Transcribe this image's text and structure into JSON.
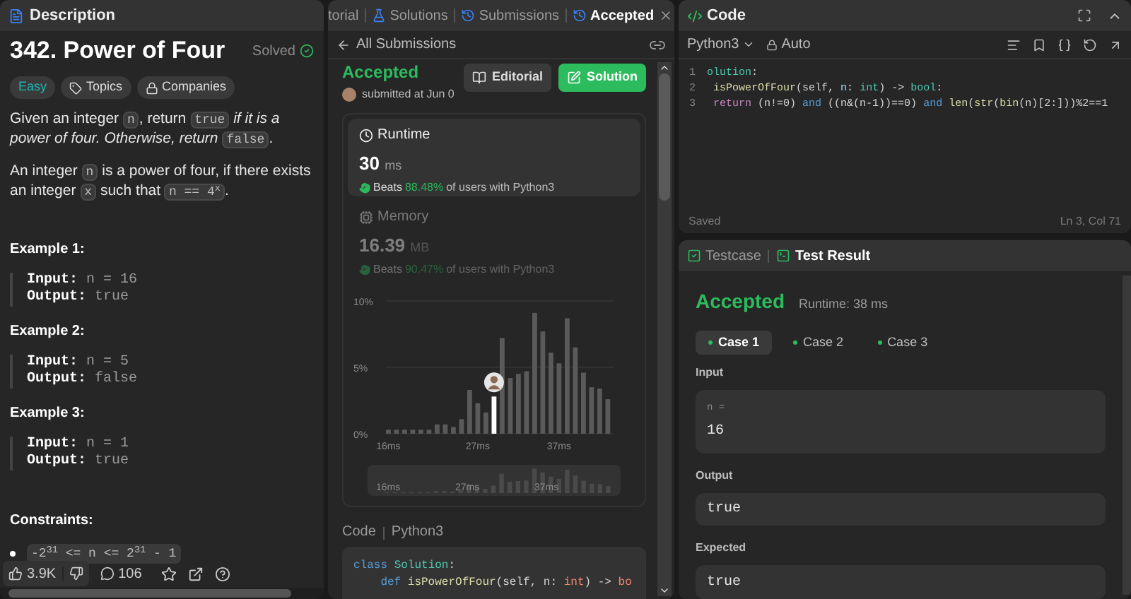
{
  "description_panel": {
    "tab": "Description",
    "title": "342. Power of Four",
    "status": "Solved",
    "tags": [
      {
        "kind": "difficulty",
        "label": "Easy"
      },
      {
        "kind": "topics",
        "label": "Topics"
      },
      {
        "kind": "companies",
        "label": "Companies"
      }
    ],
    "paragraphs": [
      [
        {
          "kind": "text",
          "text": "Given an integer "
        },
        {
          "kind": "code",
          "text": "n"
        },
        {
          "kind": "text",
          "text": ", return "
        },
        {
          "kind": "code",
          "text": "true"
        },
        {
          "kind": "italic",
          "text": " if it is a power of four. Otherwise, return "
        },
        {
          "kind": "code",
          "text": "false"
        },
        {
          "kind": "text",
          "text": "."
        }
      ],
      [
        {
          "kind": "text",
          "text": "An integer "
        },
        {
          "kind": "code",
          "text": "n"
        },
        {
          "kind": "text",
          "text": " is a power of four, if there exists an integer "
        },
        {
          "kind": "code",
          "text": "x"
        },
        {
          "kind": "text",
          "text": " such that "
        },
        {
          "kind": "code",
          "text": "n == 4$^{x}$"
        },
        {
          "kind": "text",
          "text": "."
        }
      ]
    ],
    "examples": [
      {
        "title": "Example 1:",
        "lines": [
          {
            "label": "Input:",
            "value": "n = 16"
          },
          {
            "label": "Output:",
            "value": "true"
          }
        ]
      },
      {
        "title": "Example 2:",
        "lines": [
          {
            "label": "Input:",
            "value": "n = 5"
          },
          {
            "label": "Output:",
            "value": "false"
          }
        ]
      },
      {
        "title": "Example 3:",
        "lines": [
          {
            "label": "Input:",
            "value": "n = 1"
          },
          {
            "label": "Output:",
            "value": "true"
          }
        ]
      }
    ],
    "constraints": {
      "title": "Constraints:",
      "items": [
        "-2$^{31}$ <= n <= 2$^{31}$ - 1"
      ]
    },
    "toolbar": {
      "likes": "3.9K",
      "comments": "106"
    }
  },
  "submission_panel": {
    "tabs": [
      {
        "kind": "editorial",
        "label": "torial",
        "selected": false,
        "closable": false
      },
      {
        "kind": "solutions",
        "label": "Solutions",
        "selected": false,
        "closable": false
      },
      {
        "kind": "submissions",
        "label": "Submissions",
        "selected": false,
        "closable": false
      },
      {
        "kind": "accepted",
        "label": "Accepted",
        "selected": true,
        "closable": true
      }
    ],
    "back_link": "All Submissions",
    "status": "Accepted",
    "submitted": "submitted at Jun 0",
    "buttons": [
      {
        "kind": "secondary",
        "label": "Editorial"
      },
      {
        "kind": "primary",
        "label": "Solution"
      }
    ],
    "stats": [
      {
        "kind": "runtime",
        "label": "Runtime",
        "selected": true,
        "value": "30",
        "unit": "ms",
        "beats": "Beats",
        "percent": "88.48%",
        "suffix": "of users with Python3"
      },
      {
        "kind": "memory",
        "label": "Memory",
        "selected": false,
        "value": "16.39",
        "unit": "MB",
        "beats": "Beats",
        "percent": "90.47%",
        "suffix": "of users with Python3"
      }
    ],
    "chart_data": {
      "type": "bar",
      "x": [
        16,
        17,
        18,
        19,
        20,
        21,
        22,
        23,
        24,
        25,
        26,
        27,
        28,
        29,
        30,
        31,
        32,
        33,
        34,
        35,
        36,
        37,
        38,
        39,
        40,
        41,
        42,
        43
      ],
      "series": [
        {
          "color": "#5a5a5a",
          "values": [
            0.3,
            0.3,
            0.3,
            0.3,
            0.3,
            0.3,
            0.7,
            0.7,
            0.5,
            1.1,
            3.3,
            2.3,
            1.6,
            null,
            7.2,
            4.2,
            4.5,
            4.7,
            9.1,
            7.7,
            6.1,
            5.3,
            8.7,
            6.5,
            4.6,
            3.5,
            3.4,
            2.6
          ]
        },
        {
          "color": "#ffffff",
          "values": [
            null,
            null,
            null,
            null,
            null,
            null,
            null,
            null,
            null,
            null,
            null,
            null,
            null,
            2.8,
            null,
            null,
            null,
            null,
            null,
            null,
            null,
            null,
            null,
            null,
            null,
            null,
            null,
            null
          ]
        }
      ],
      "xlim": [
        15.5,
        43.5
      ],
      "ylim": [
        0,
        10
      ],
      "yticks": [
        {
          "value": 0,
          "label": "0%"
        },
        {
          "value": 5,
          "label": "5%"
        },
        {
          "value": 10,
          "label": "10%"
        }
      ],
      "xticks": [
        {
          "value": 16,
          "label": "16ms"
        },
        {
          "value": 27,
          "label": "27ms"
        },
        {
          "value": 37,
          "label": "37ms"
        }
      ]
    },
    "overview_labels": [
      "16ms",
      "27ms",
      "37ms"
    ],
    "code_header": {
      "label": "Code",
      "language": "Python3"
    },
    "code_lines": [
      [
        {
          "kind": "keyword",
          "text": "class "
        },
        {
          "kind": "class",
          "text": "Solution"
        },
        {
          "kind": "plain",
          "text": ":"
        }
      ],
      [
        {
          "kind": "keyword",
          "text": "    def "
        },
        {
          "kind": "function",
          "text": "isPowerOfFour"
        },
        {
          "kind": "plain",
          "text": "(self, n: "
        },
        {
          "kind": "type",
          "text": "int"
        },
        {
          "kind": "plain",
          "text": ") -> "
        },
        {
          "kind": "type",
          "text": "bo"
        }
      ]
    ]
  },
  "code_editor": {
    "title": "Code",
    "language": "Python3",
    "mode": "Auto",
    "lines": [
      {
        "number": "1",
        "tokens": [
          {
            "kind": "class",
            "text": "olution"
          },
          {
            "kind": "plain",
            "text": ":"
          }
        ]
      },
      {
        "number": "2",
        "tokens": [
          {
            "kind": "function",
            "text": " isPowerOfFour"
          },
          {
            "kind": "plain",
            "text": "(self, "
          },
          {
            "kind": "param",
            "text": "n"
          },
          {
            "kind": "plain",
            "text": ": "
          },
          {
            "kind": "class",
            "text": "int"
          },
          {
            "kind": "plain",
            "text": ") -> "
          },
          {
            "kind": "class",
            "text": "bool"
          },
          {
            "kind": "plain",
            "text": ":"
          }
        ]
      },
      {
        "number": "3",
        "tokens": [
          {
            "kind": "control",
            "text": " return"
          },
          {
            "kind": "plain",
            "text": " (n!=0) "
          },
          {
            "kind": "keyword",
            "text": "and"
          },
          {
            "kind": "plain",
            "text": " ((n&(n-1))==0) "
          },
          {
            "kind": "keyword",
            "text": "and "
          },
          {
            "kind": "function",
            "text": "len"
          },
          {
            "kind": "plain",
            "text": "("
          },
          {
            "kind": "function",
            "text": "str"
          },
          {
            "kind": "plain",
            "text": "("
          },
          {
            "kind": "function",
            "text": "bin"
          },
          {
            "kind": "plain",
            "text": "(n)[2:]))%2==1"
          }
        ]
      }
    ],
    "status": "Saved",
    "cursor": "Ln 3, Col 71"
  },
  "test_result": {
    "tabs": [
      {
        "kind": "testcase",
        "label": "Testcase",
        "selected": false
      },
      {
        "kind": "result",
        "label": "Test Result",
        "selected": true
      }
    ],
    "verdict": "Accepted",
    "runtime": "Runtime: 38 ms",
    "cases": [
      {
        "label": "Case 1",
        "selected": true,
        "passed": true
      },
      {
        "label": "Case 2",
        "selected": false,
        "passed": true
      },
      {
        "label": "Case 3",
        "selected": false,
        "passed": true
      }
    ],
    "input_label": "Input",
    "inputs": [
      {
        "name": "n =",
        "value": "16"
      }
    ],
    "output_label": "Output",
    "output": "true",
    "expected_label": "Expected",
    "expected": "true"
  }
}
